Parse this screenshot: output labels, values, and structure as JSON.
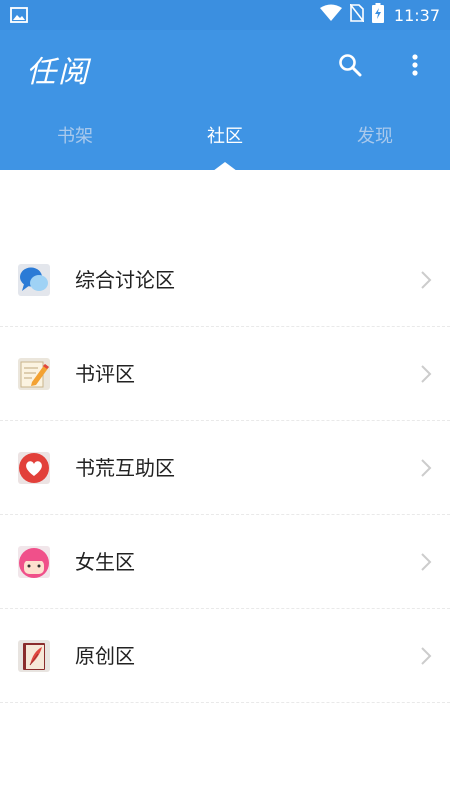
{
  "status_bar": {
    "time": "11:37",
    "icons": [
      "gallery-notification-icon",
      "wifi-icon",
      "no-sim-icon",
      "battery-charging-icon"
    ]
  },
  "app_bar": {
    "title": "任阅",
    "search_icon": "search-icon",
    "more_icon": "more-vertical-icon"
  },
  "tabs": [
    {
      "label": "书架",
      "active": false
    },
    {
      "label": "社区",
      "active": true
    },
    {
      "label": "发现",
      "active": false
    }
  ],
  "community_list": [
    {
      "label": "综合讨论区",
      "icon": "chat-bubbles-icon"
    },
    {
      "label": "书评区",
      "icon": "notepad-pencil-icon"
    },
    {
      "label": "书荒互助区",
      "icon": "heart-icon"
    },
    {
      "label": "女生区",
      "icon": "girl-face-icon"
    },
    {
      "label": "原创区",
      "icon": "book-quill-icon"
    }
  ],
  "colors": {
    "primary": "#3f94e4",
    "status_bar": "#3b8fe0",
    "tab_inactive": "#a9c9ec",
    "text": "#222222",
    "chevron": "#cccccc"
  }
}
